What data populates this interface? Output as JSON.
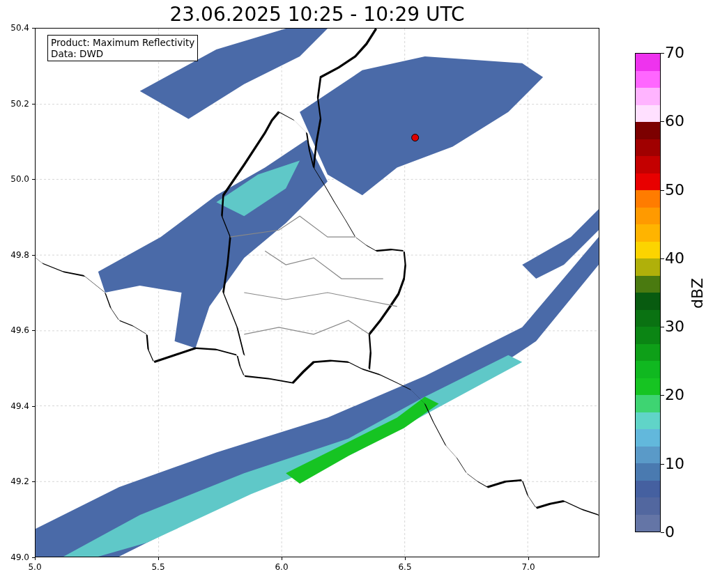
{
  "title": "23.06.2025 10:25 - 10:29 UTC",
  "map": {
    "info_lines": [
      "Product: Maximum Reflectivity",
      "Data: DWD"
    ],
    "x_ticks": [
      "5.0",
      "5.5",
      "6.0",
      "6.5",
      "7.0"
    ],
    "y_ticks": [
      "50.4",
      "50.2",
      "50.0",
      "49.8",
      "49.6",
      "49.4",
      "49.2",
      "49.0"
    ]
  },
  "colorbar": {
    "label": "dBZ",
    "ticks": [
      "70",
      "60",
      "50",
      "40",
      "30",
      "20",
      "10",
      "0"
    ],
    "segments": [
      {
        "color": "#ee33ee"
      },
      {
        "color": "#ff66ff"
      },
      {
        "color": "#ffb4ff"
      },
      {
        "color": "#ffe0ff"
      },
      {
        "color": "#7c0000"
      },
      {
        "color": "#a00000"
      },
      {
        "color": "#c40000"
      },
      {
        "color": "#e80000"
      },
      {
        "color": "#ff7c00"
      },
      {
        "color": "#ff9a00"
      },
      {
        "color": "#ffb400"
      },
      {
        "color": "#fcd400"
      },
      {
        "color": "#b0b00a"
      },
      {
        "color": "#4a7a10"
      },
      {
        "color": "#085b10"
      },
      {
        "color": "#0a7212"
      },
      {
        "color": "#0b8514"
      },
      {
        "color": "#0e9f18"
      },
      {
        "color": "#10b820"
      },
      {
        "color": "#16c422"
      },
      {
        "color": "#3ed472"
      },
      {
        "color": "#60d4c8"
      },
      {
        "color": "#62b8dc"
      },
      {
        "color": "#5a9ac8"
      },
      {
        "color": "#4a7ab0"
      },
      {
        "color": "#4560a0"
      },
      {
        "color": "#52679f"
      },
      {
        "color": "#6475a6"
      }
    ]
  }
}
